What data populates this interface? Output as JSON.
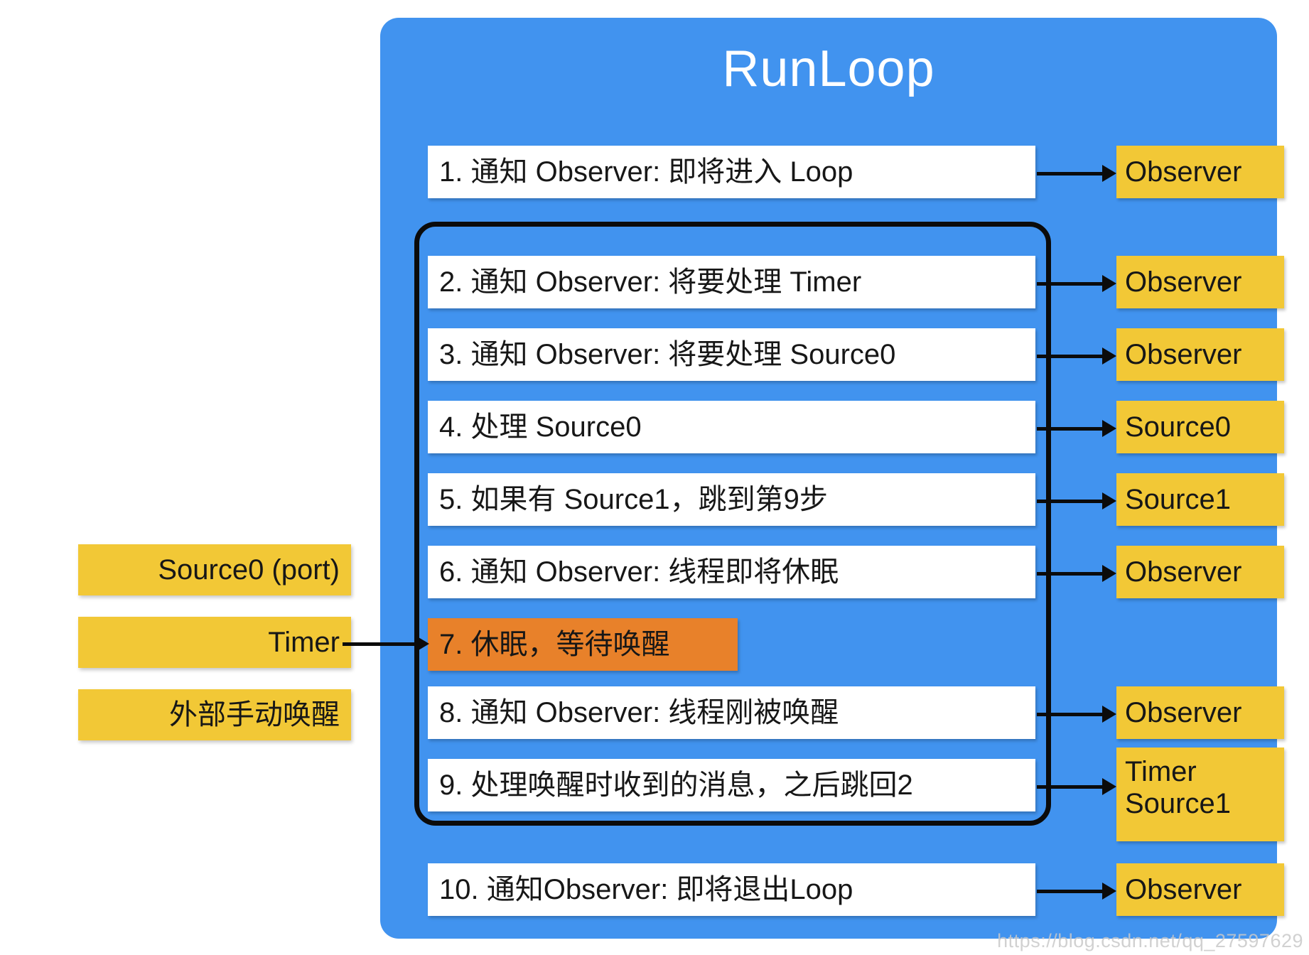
{
  "diagram": {
    "title": "RunLoop",
    "panel_color": "#4193ef",
    "tag_color": "#f2c836",
    "highlight_color": "#e8812a",
    "step_bg": "#ffffff",
    "border_color": "#0b0b0b"
  },
  "steps": [
    {
      "label": "1. 通知 Observer: 即将进入 Loop"
    },
    {
      "label": "2. 通知 Observer: 将要处理 Timer"
    },
    {
      "label": "3. 通知 Observer: 将要处理 Source0"
    },
    {
      "label": "4. 处理 Source0"
    },
    {
      "label": "5. 如果有 Source1，跳到第9步"
    },
    {
      "label": "6. 通知 Observer: 线程即将休眠"
    },
    {
      "label": "7. 休眠，等待唤醒"
    },
    {
      "label": "8. 通知 Observer: 线程刚被唤醒"
    },
    {
      "label": "9. 处理唤醒时收到的消息，之后跳回2"
    },
    {
      "label": "10. 通知Observer: 即将退出Loop"
    }
  ],
  "right_tags": [
    {
      "label": "Observer"
    },
    {
      "label": "Observer"
    },
    {
      "label": "Observer"
    },
    {
      "label": "Source0"
    },
    {
      "label": "Source1"
    },
    {
      "label": "Observer"
    },
    {
      "label": "Observer"
    },
    {
      "label_line1": "Timer",
      "label_line2": "Source1"
    },
    {
      "label": "Observer"
    }
  ],
  "left_tags": [
    {
      "label": "Source0 (port)"
    },
    {
      "label": "Timer"
    },
    {
      "label": "外部手动唤醒"
    }
  ],
  "watermark": {
    "text": "https://blog.csdn.net/qq_27597629"
  }
}
